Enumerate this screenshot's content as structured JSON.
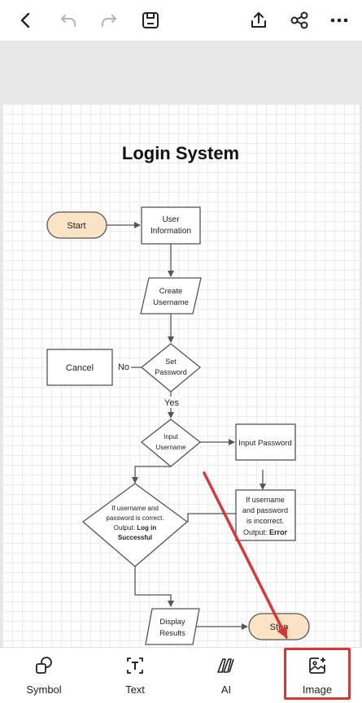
{
  "toolbar": {
    "back": "back-icon",
    "undo": "undo-icon",
    "redo": "redo-icon",
    "save": "save-icon",
    "export": "export-icon",
    "share": "share-icon",
    "more": "more-icon"
  },
  "diagram": {
    "title": "Login System",
    "start": "Start",
    "user_info": [
      "User",
      "Information"
    ],
    "create_username": [
      "Create",
      "Username"
    ],
    "set_password": [
      "Set",
      "Password"
    ],
    "cancel": "Cancel",
    "no_label": "No",
    "yes_label": "Yes",
    "input_username": [
      "Input",
      "Username"
    ],
    "input_password": "Input Password",
    "correct": [
      "If username and",
      "password is correct.",
      "Output: ",
      "Log in",
      "Successful"
    ],
    "incorrect": [
      "If username",
      "and password",
      "is incorrect.",
      "Output: ",
      "Error"
    ],
    "display_results": [
      "Display",
      "Results"
    ],
    "stop": "Stop"
  },
  "bottom_tools": [
    {
      "label": "Symbol",
      "icon": "symbol-icon"
    },
    {
      "label": "Text",
      "icon": "text-icon"
    },
    {
      "label": "AI",
      "icon": "ai-icon"
    },
    {
      "label": "Image",
      "icon": "image-icon"
    }
  ],
  "colors": {
    "terminal_fill": "#fbe4c6",
    "annotation": "#d63838",
    "shape_stroke": "#555555"
  }
}
